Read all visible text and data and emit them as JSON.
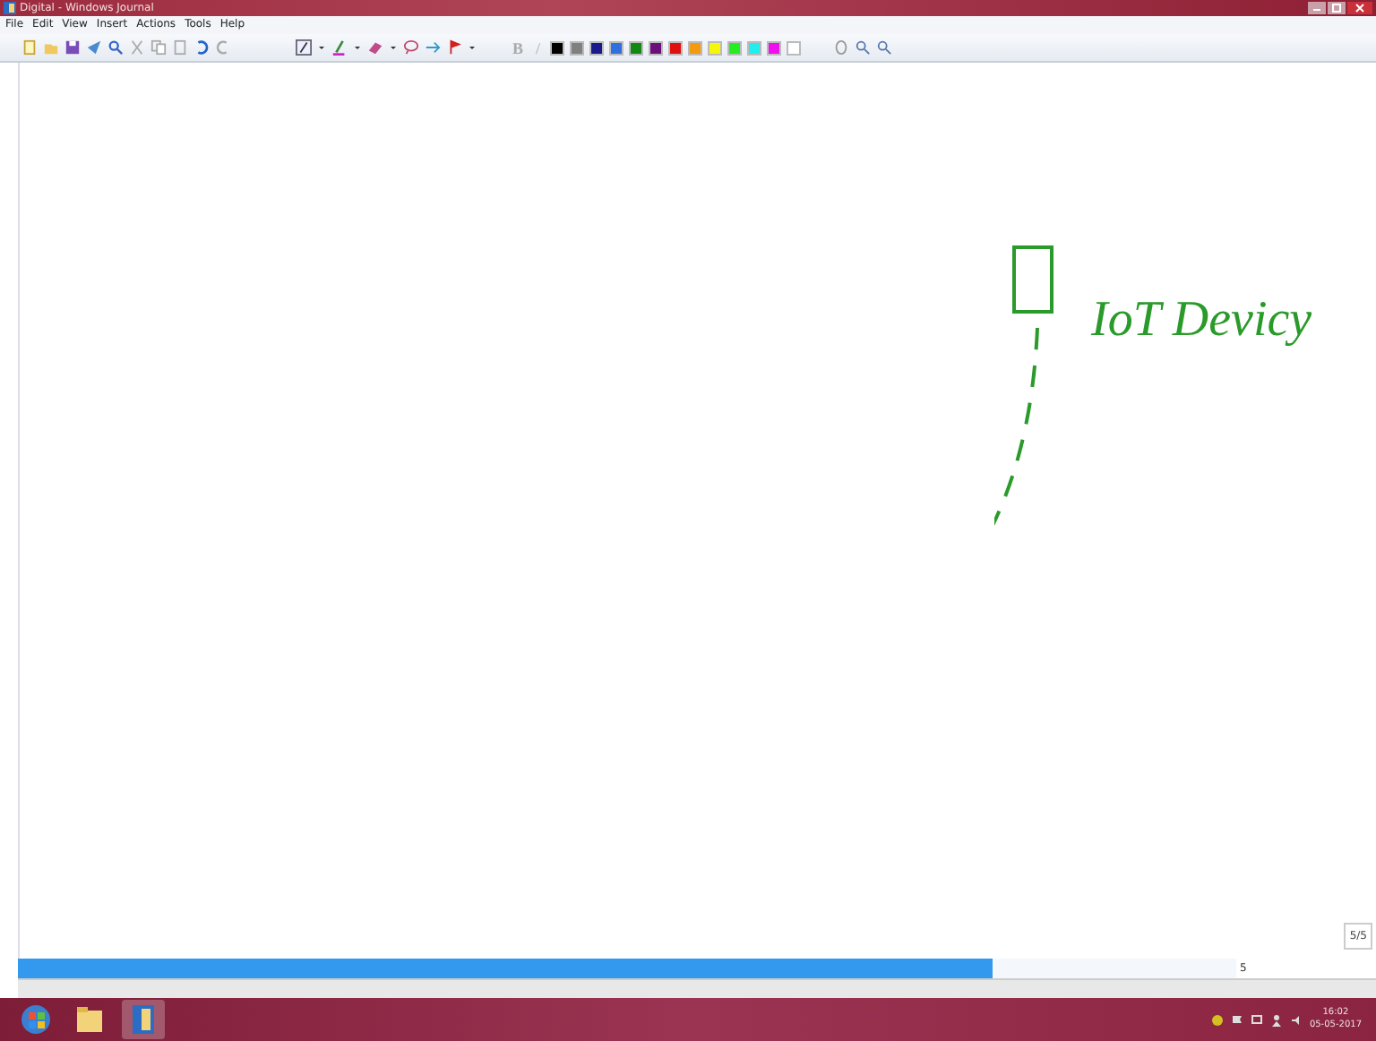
{
  "window": {
    "title": "Digital - Windows Journal"
  },
  "menu": [
    "File",
    "Edit",
    "View",
    "Insert",
    "Actions",
    "Tools",
    "Help"
  ],
  "toolbar": {
    "bold_label": "B",
    "italic_label": "/",
    "swatches": [
      {
        "color": "#000000"
      },
      {
        "color": "#808080"
      },
      {
        "color": "#1a1a8c"
      },
      {
        "color": "#2f6fe0"
      },
      {
        "color": "#118811"
      },
      {
        "color": "#6b0f7a"
      },
      {
        "color": "#e01010"
      },
      {
        "color": "#f49a10"
      },
      {
        "color": "#f6f60a"
      },
      {
        "color": "#22ee22"
      },
      {
        "color": "#22eeee"
      },
      {
        "color": "#ee11ee"
      },
      {
        "color": "#ffffff"
      }
    ]
  },
  "ink": {
    "text": "IoT Devicy"
  },
  "page": {
    "indicator": "5/5",
    "number": "5",
    "progress": {
      "level": 0.8
    }
  },
  "clock": {
    "time": "16:02",
    "date": "05-05-2017"
  }
}
